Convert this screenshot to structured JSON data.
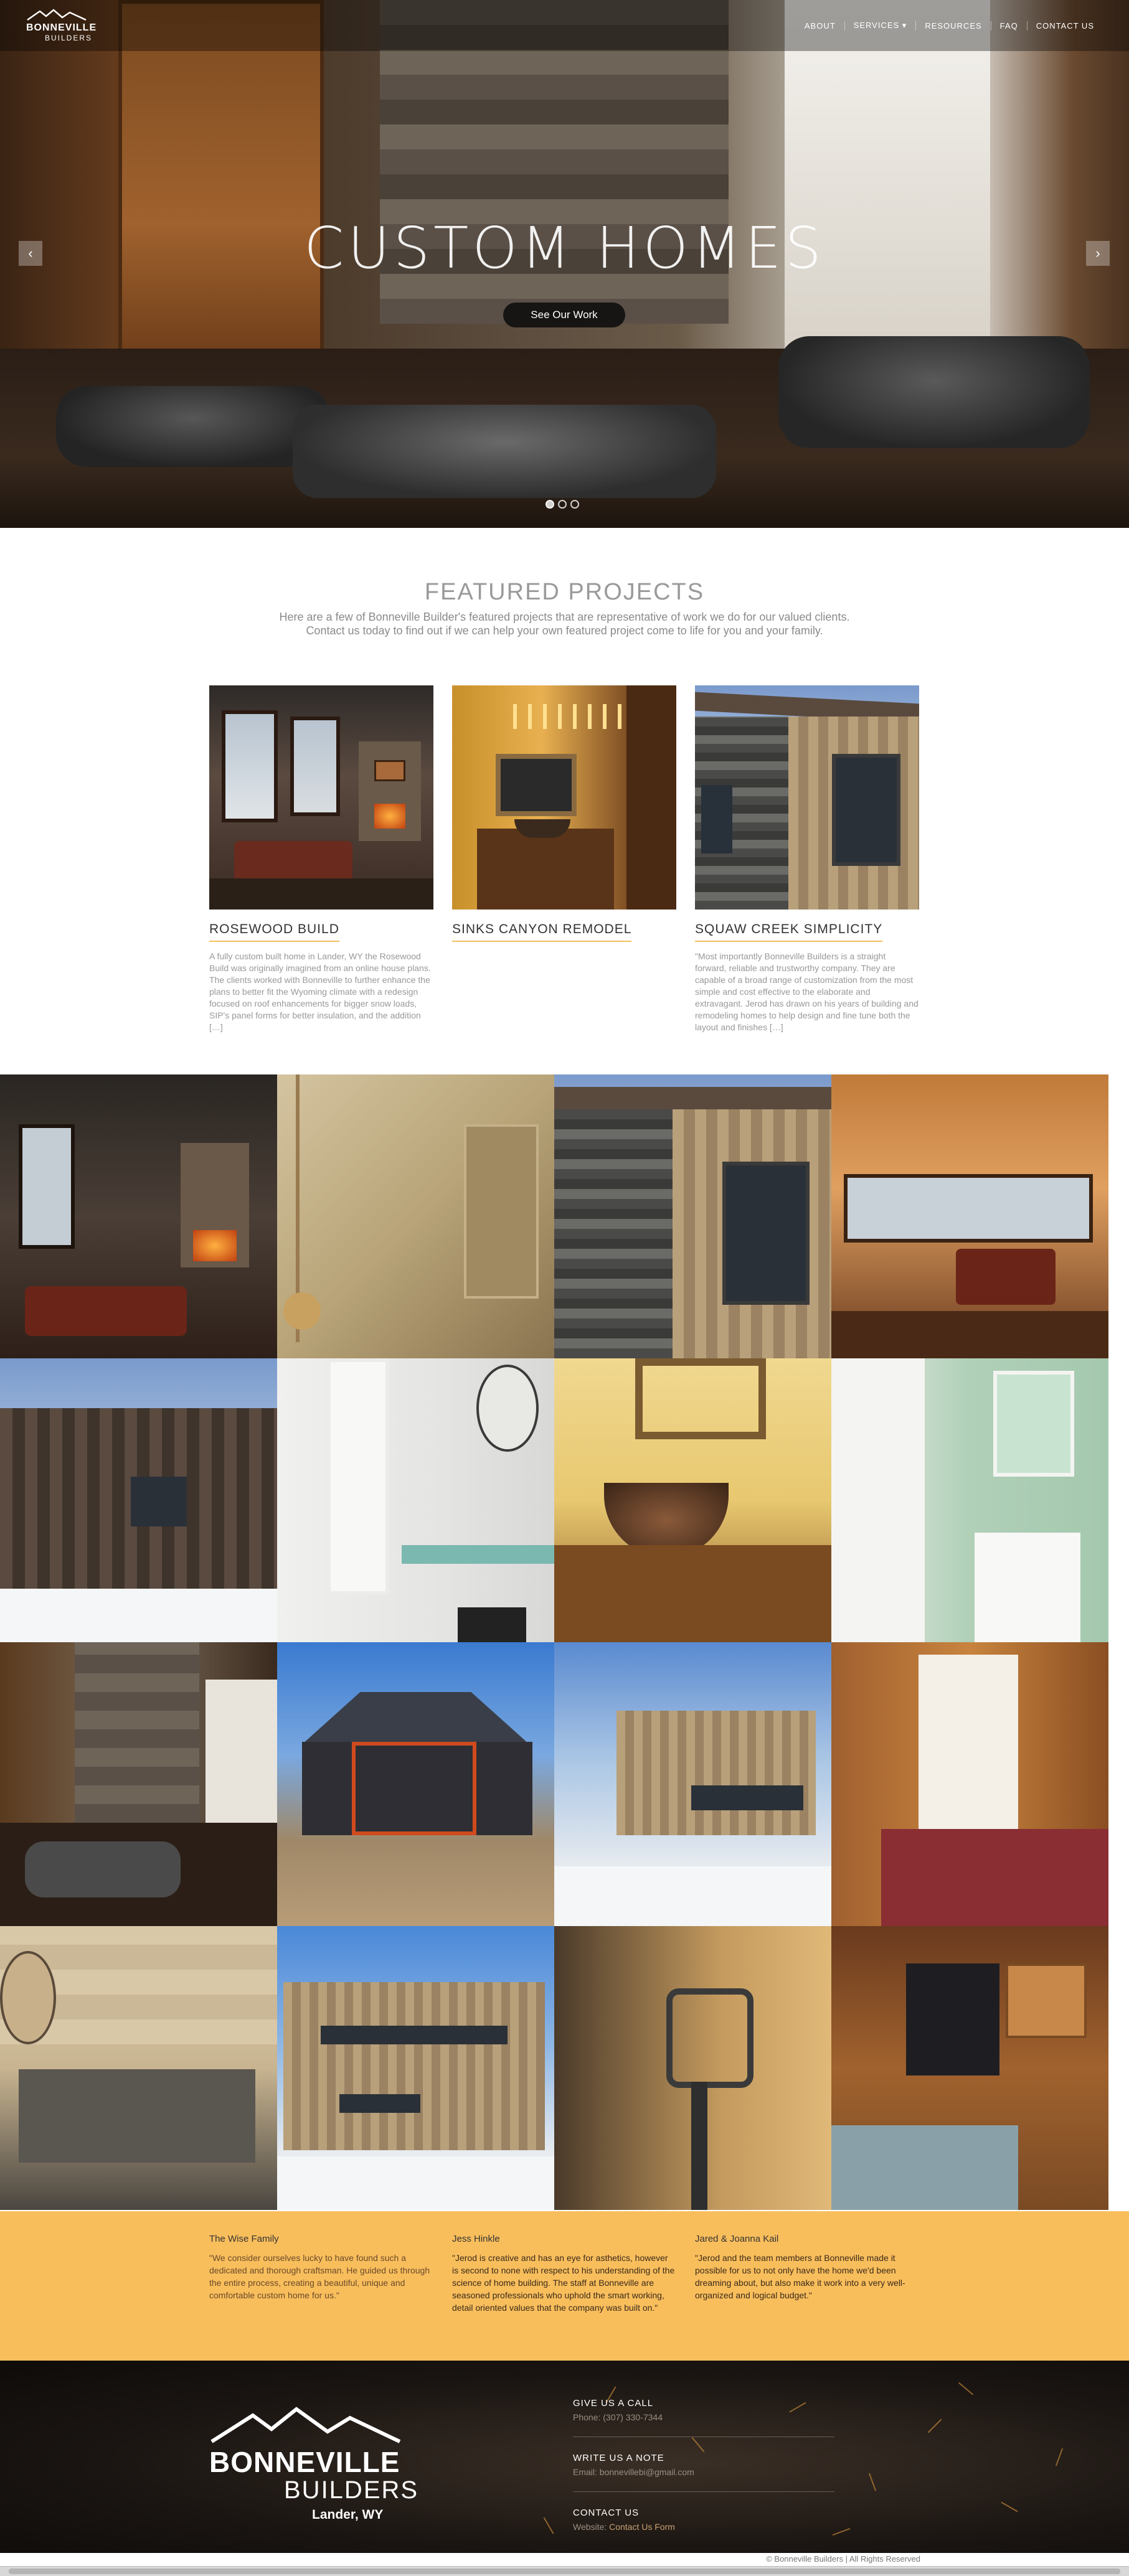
{
  "nav": {
    "logo_line1": "BONNEVILLE",
    "logo_line2": "BUILDERS",
    "items": [
      {
        "label": "ABOUT"
      },
      {
        "label": "SERVICES ▾"
      },
      {
        "label": "RESOURCES"
      },
      {
        "label": "FAQ"
      },
      {
        "label": "CONTACT US"
      }
    ]
  },
  "hero": {
    "title": "CUSTOM HOMES",
    "button": "See Our Work",
    "prev": "‹",
    "next": "›",
    "slides": 3,
    "active_slide": 1
  },
  "featured": {
    "title": "FEATURED PROJECTS",
    "subtitle": "Here are a few of Bonneville Builder's featured projects that are representative of work we do for our valued clients. Contact us today to find out if we can help your own featured project come to life for you and your family.",
    "projects": [
      {
        "name": "ROSEWOOD BUILD",
        "desc": "A fully custom built home in Lander, WY the Rosewood Build was originally imagined from an online house plans. The clients worked with Bonneville to further enhance the plans to better fit the Wyoming climate with a redesign focused on roof enhancements for bigger snow loads, SIP's panel forms for better insulation, and the addition […]"
      },
      {
        "name": "SINKS CANYON REMODEL",
        "desc": ""
      },
      {
        "name": "SQUAW CREEK SIMPLICITY",
        "desc": "\"Most importantly Bonneville Builders is a straight forward, reliable and trustworthy company.  They are capable of a broad range of customization from the most simple and cost effective to the elaborate and extravagant. Jerod has drawn on his years of building and remodeling homes to help design and fine tune both the layout and finishes […]"
      }
    ]
  },
  "testimonials": [
    {
      "who": "The Wise Family",
      "quote": "\"We consider ourselves lucky to have found such a dedicated and thorough craftsman. He guided us through the entire process, creating a beautiful, unique and comfortable custom home for us.\""
    },
    {
      "who": "Jess Hinkle",
      "quote": "\"Jerod is creative and has an eye for asthetics, however is second to none with respect to his understanding of the science of home building. The staff at Bonneville are seasoned professionals who uphold the smart working, detail oriented values that the company was built on.\""
    },
    {
      "who": "Jared & Joanna Kail",
      "quote": "\"Jerod and the team members at Bonneville made it possible for us to not only have the home we'd been dreaming about, but also make it work into a very well-organized and logical budget.\""
    }
  ],
  "footer": {
    "logo_line1": "BONNEVILLE",
    "logo_line2": "BUILDERS",
    "logo_line3": "Lander, WY",
    "call_h": "GIVE US A CALL",
    "call_v": "Phone: (307) 330-7344",
    "write_h": "WRITE US A NOTE",
    "write_v": "Email: bonnevillebi@gmail.com",
    "contact_h": "CONTACT US",
    "contact_label": "Website:",
    "contact_link": "Contact Us Form",
    "copyright": "© Bonneville Builders | All Rights Reserved"
  },
  "colors": {
    "accent": "#f4c05a",
    "testimonial_bg": "#f9be5c",
    "footer_bg": "#1a1512"
  }
}
